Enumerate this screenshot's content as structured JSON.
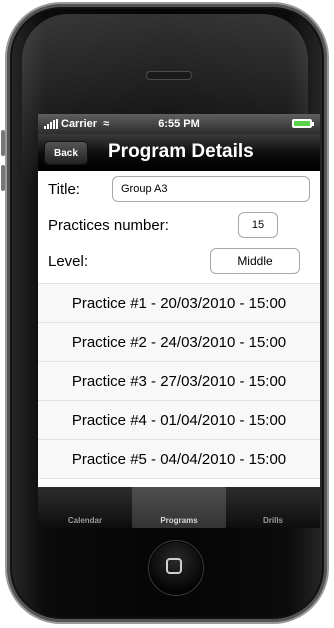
{
  "status_bar": {
    "carrier": "Carrier",
    "time": "6:55 PM"
  },
  "nav": {
    "back_label": "Back",
    "title": "Program Details"
  },
  "form": {
    "title_label": "Title:",
    "title_value": "Group A3",
    "practices_label": "Practices number:",
    "practices_value": "15",
    "level_label": "Level:",
    "level_value": "Middle"
  },
  "practices": [
    "Practice #1 - 20/03/2010 - 15:00",
    "Practice #2 - 24/03/2010 - 15:00",
    "Practice #3 - 27/03/2010 - 15:00",
    "Practice #4 - 01/04/2010 - 15:00",
    "Practice #5 - 04/04/2010 - 15:00"
  ],
  "tabs": [
    {
      "label": "Calendar",
      "active": false
    },
    {
      "label": "Programs",
      "active": true
    },
    {
      "label": "Drills",
      "active": false
    }
  ]
}
